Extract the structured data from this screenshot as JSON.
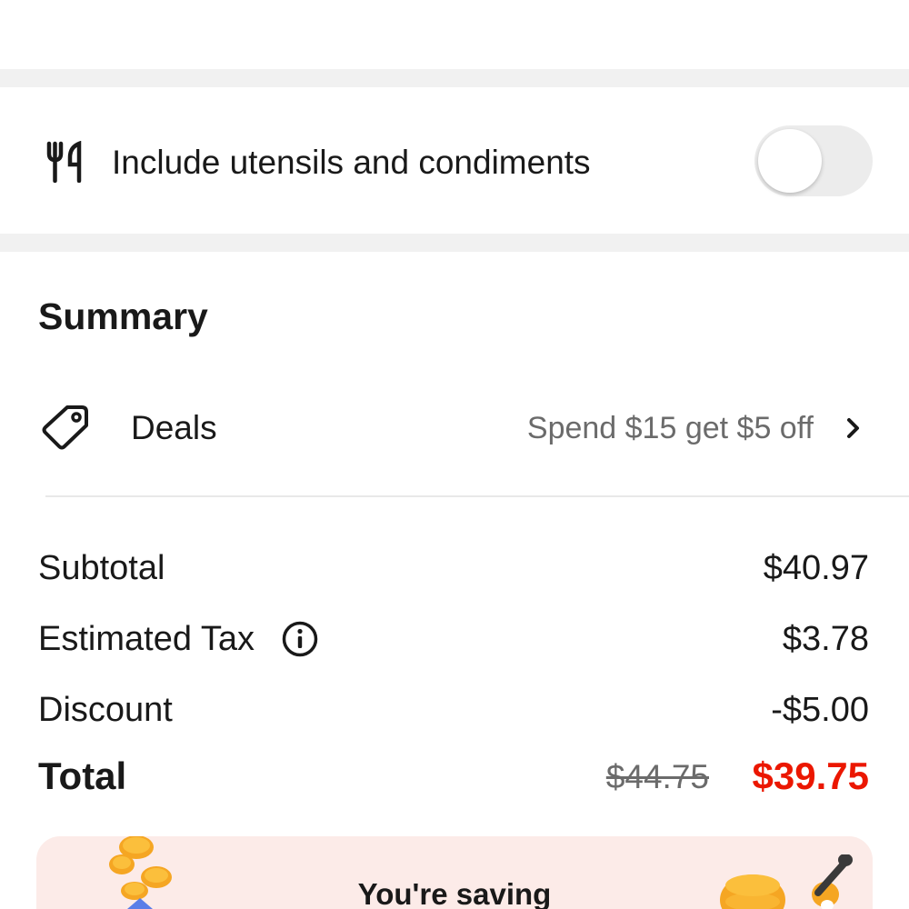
{
  "options": {
    "utensils": {
      "icon": "utensils-icon",
      "label": "Include utensils and condiments",
      "enabled": false
    }
  },
  "summary": {
    "title": "Summary",
    "deals": {
      "icon": "tag-icon",
      "label": "Deals",
      "value": "Spend $15 get $5 off",
      "chevron": "chevron-right-icon"
    },
    "lines": {
      "subtotal": {
        "label": "Subtotal",
        "value": "$40.97"
      },
      "tax": {
        "label": "Estimated Tax",
        "value": "$3.78",
        "icon": "info-icon"
      },
      "discount": {
        "label": "Discount",
        "value": "-$5.00"
      }
    },
    "total": {
      "label": "Total",
      "original": "$44.75",
      "final": "$39.75"
    }
  },
  "savings_banner": {
    "text": "You're saving",
    "icons": [
      "coins-icon",
      "coin-jar-icon"
    ]
  },
  "colors": {
    "accent_red": "#eb1700",
    "muted_text": "#6b6b6b",
    "section_band": "#f1f1f1",
    "savings_bg": "#fcebe8"
  }
}
